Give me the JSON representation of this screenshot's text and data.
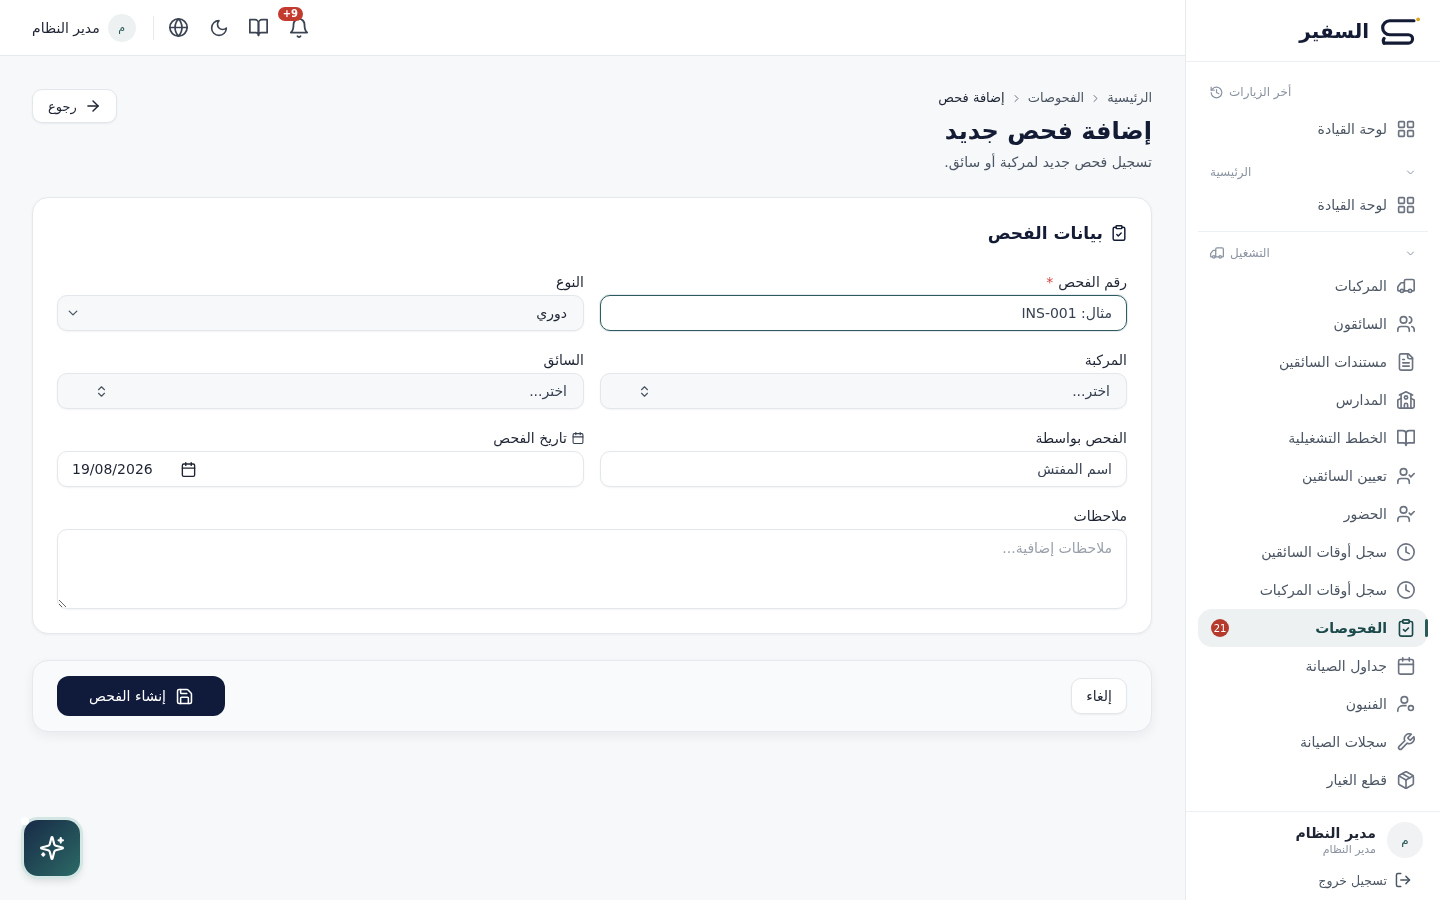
{
  "topbar": {
    "notification_count": "+9",
    "user": {
      "avatar": "م",
      "name": "مدير النظام"
    }
  },
  "sidebar": {
    "brand": "السفير",
    "sections": [
      {
        "kind": "recent",
        "title": "أخر الزيارات",
        "items": [
          {
            "label": "لوحة القيادة",
            "selected": false
          }
        ]
      },
      {
        "kind": "group",
        "title": "الرئيسية",
        "expanded": true,
        "items": [
          {
            "label": "لوحة القيادة",
            "selected": false
          }
        ]
      },
      {
        "kind": "group",
        "title": "التشغيل",
        "expanded": true,
        "items": [
          {
            "label": "المركبات",
            "selected": false
          },
          {
            "label": "السائقون",
            "selected": false
          },
          {
            "label": "مستندات السائقين",
            "selected": false
          },
          {
            "label": "المدارس",
            "selected": false
          },
          {
            "label": "الخطط التشغيلية",
            "selected": false
          },
          {
            "label": "تعيين السائقين",
            "selected": false
          },
          {
            "label": "الحضور",
            "selected": false
          },
          {
            "label": "سجل أوقات السائقين",
            "selected": false
          },
          {
            "label": "سجل أوقات المركبات",
            "selected": false
          },
          {
            "label": "الفحوصات",
            "selected": true,
            "badge": "21"
          },
          {
            "label": "جداول الصيانة",
            "selected": false
          },
          {
            "label": "الفنيون",
            "selected": false
          },
          {
            "label": "سجلات الصيانة",
            "selected": false
          },
          {
            "label": "قطع الغيار",
            "selected": false
          }
        ]
      }
    ],
    "user": {
      "avatar": "م",
      "name": "مدير النظام",
      "role": "مدير النظام"
    },
    "logout": "تسجيل خروج"
  },
  "page": {
    "breadcrumb": [
      "الرئيسية",
      "الفحوصات",
      "إضافة فحص"
    ],
    "title": "إضافة فحص جديد",
    "subtitle": "تسجيل فحص جديد لمركبة أو سائق.",
    "back_button": "رجوع"
  },
  "form": {
    "title": "بيانات الفحص",
    "fields": [
      {
        "kind": "text",
        "label": "رقم الفحص",
        "required_mark": "*",
        "placeholder": "مثال: INS-001",
        "focused": true
      },
      {
        "kind": "select",
        "label": "النوع",
        "value": "دوري",
        "focused": false
      },
      {
        "kind": "combobox",
        "label": "المركبة",
        "placeholder": "اختر...",
        "focused": false
      },
      {
        "kind": "combobox",
        "label": "السائق",
        "placeholder": "اختر...",
        "focused": false
      },
      {
        "kind": "text",
        "label": "الفحص بواسطة",
        "placeholder": "اسم المفتش",
        "focused": false
      },
      {
        "kind": "date",
        "label": "تاريخ الفحص",
        "value": "19/08/2026",
        "focused": false
      },
      {
        "kind": "textarea",
        "label": "ملاحظات",
        "placeholder": "ملاحظات إضافية...",
        "focused": false
      }
    ]
  },
  "actions": {
    "cancel": "إلغاء",
    "submit": "إنشاء الفحص"
  }
}
